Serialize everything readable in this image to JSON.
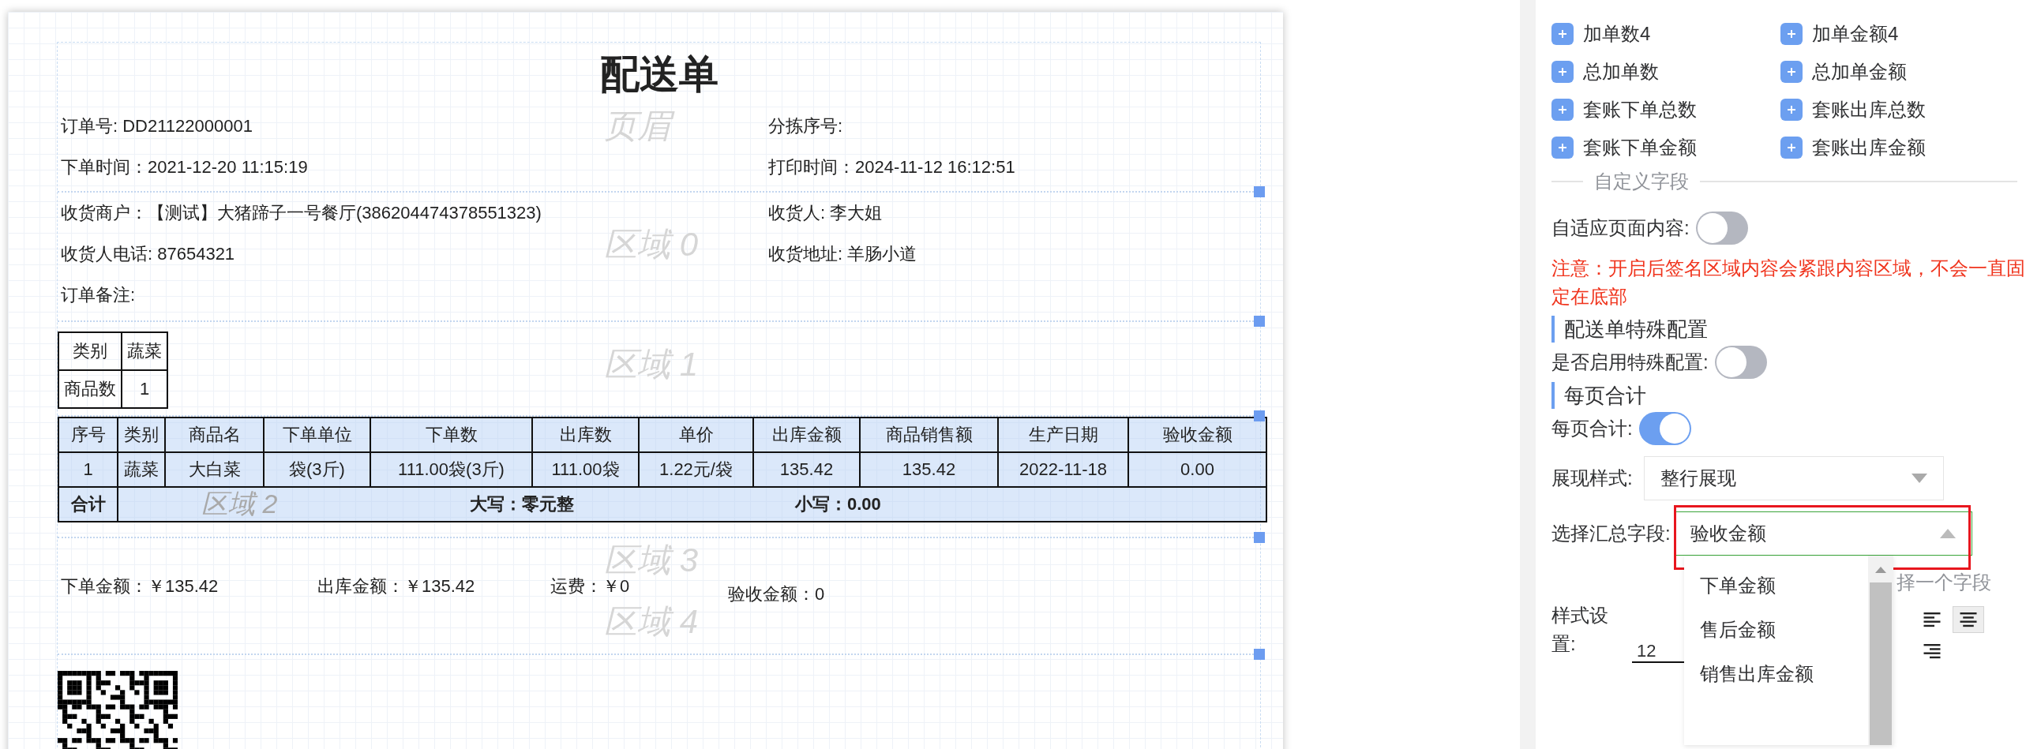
{
  "document": {
    "title": "配送单",
    "region_labels": [
      "页眉",
      "区域 0",
      "区域 1",
      "区域 2",
      "区域 3",
      "区域 4"
    ],
    "header_rows": [
      [
        "订单号: DD21122000001",
        "分拣序号:"
      ],
      [
        "下单时间：2021-12-20 11:15:19",
        "打印时间：2024-11-12 16:12:51"
      ]
    ],
    "info_rows": [
      [
        "收货商户：【测试】大猪蹄子一号餐厅(386204474378551323)",
        "收货人: 李大姐"
      ],
      [
        "收货人电话: 87654321",
        "收货地址: 羊肠小道"
      ],
      [
        "订单备注:"
      ]
    ],
    "summary_table": [
      [
        "类别",
        "蔬菜"
      ],
      [
        "商品数",
        "1"
      ]
    ],
    "items_table": {
      "columns": [
        "序号",
        "类别",
        "商品名",
        "下单单位",
        "下单数",
        "出库数",
        "单价",
        "出库金额",
        "商品销售额",
        "生产日期",
        "验收金额"
      ],
      "rows": [
        [
          "1",
          "蔬菜",
          "大白菜",
          "袋(3斤)",
          "111.00袋(3斤)",
          "111.00袋",
          "1.22元/袋",
          "135.42",
          "135.42",
          "2022-11-18",
          "0.00"
        ]
      ],
      "total": {
        "label": "合计",
        "uppercase": "大写：零元整",
        "lowercase": "小写：0.00"
      }
    },
    "amounts": [
      "下单金额：￥135.42",
      "出库金额：￥135.42",
      "运费：￥0",
      "验收金额：0"
    ]
  },
  "panel": {
    "field_buttons": [
      "加单数4",
      "加单金额4",
      "总加单数",
      "总加单金额",
      "套账下单总数",
      "套账出库总数",
      "套账下单金额",
      "套账出库金额"
    ],
    "custom_section": "自定义字段",
    "adaptive": {
      "label": "自适应页面内容:",
      "on": false
    },
    "notice": "注意：开启后签名区域内容会紧跟内容区域，不会一直固定在底部",
    "special_heading": "配送单特殊配置",
    "special": {
      "label": "是否启用特殊配置:",
      "on": false
    },
    "per_page_heading": "每页合计",
    "per_page": {
      "label": "每页合计:",
      "on": true
    },
    "display_style": {
      "label": "展现样式:",
      "value": "整行展现"
    },
    "summary_field": {
      "label": "选择汇总字段:",
      "value": "验收金额",
      "expanded": true,
      "highlighted": true,
      "options": [
        {
          "label": "下单金额"
        },
        {
          "label": "售后金额"
        },
        {
          "label": "销售出库金额"
        }
      ]
    },
    "hidden_hint": "择一个字段",
    "style_settings": {
      "label": "样式设置:",
      "font_size": "12",
      "alignments": [
        {
          "kind": "left",
          "selected": false
        },
        {
          "kind": "center",
          "selected": true
        },
        {
          "kind": "right",
          "selected": false
        }
      ]
    }
  }
}
